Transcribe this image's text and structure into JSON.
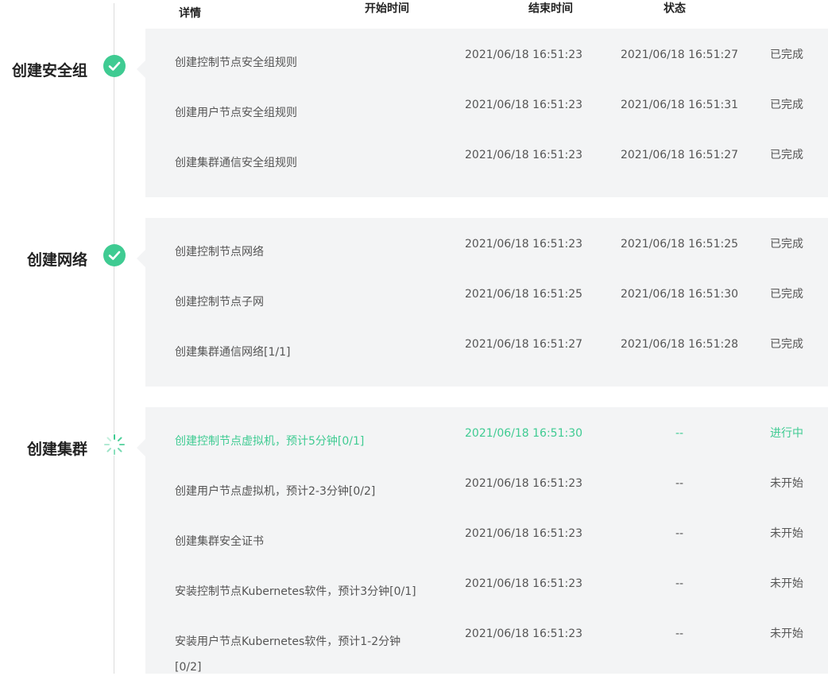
{
  "header": {
    "detail": "详情",
    "start_time": "开始时间",
    "end_time": "结束时间",
    "status": "状态"
  },
  "colors": {
    "accent": "#3fcb92",
    "panel_bg": "#f3f4f5"
  },
  "stages": [
    {
      "title": "创建安全组",
      "state": "done",
      "icon": "check-circle-icon",
      "rows": [
        {
          "detail": "创建控制节点安全组规则",
          "start": "2021/06/18 16:51:23",
          "end": "2021/06/18 16:51:27",
          "status": "已完成"
        },
        {
          "detail": "创建用户节点安全组规则",
          "start": "2021/06/18 16:51:23",
          "end": "2021/06/18 16:51:31",
          "status": "已完成"
        },
        {
          "detail": "创建集群通信安全组规则",
          "start": "2021/06/18 16:51:23",
          "end": "2021/06/18 16:51:27",
          "status": "已完成"
        }
      ]
    },
    {
      "title": "创建网络",
      "state": "done",
      "icon": "check-circle-icon",
      "rows": [
        {
          "detail": "创建控制节点网络",
          "start": "2021/06/18 16:51:23",
          "end": "2021/06/18 16:51:25",
          "status": "已完成"
        },
        {
          "detail": "创建控制节点子网",
          "start": "2021/06/18 16:51:25",
          "end": "2021/06/18 16:51:30",
          "status": "已完成"
        },
        {
          "detail": "创建集群通信网络[1/1]",
          "start": "2021/06/18 16:51:27",
          "end": "2021/06/18 16:51:28",
          "status": "已完成"
        }
      ]
    },
    {
      "title": "创建集群",
      "state": "in-progress",
      "icon": "loading-spinner-icon",
      "rows": [
        {
          "detail": "创建控制节点虚拟机，预计5分钟[0/1]",
          "start": "2021/06/18 16:51:30",
          "end": "--",
          "status": "进行中",
          "active": true
        },
        {
          "detail": "创建用户节点虚拟机，预计2-3分钟[0/2]",
          "start": "2021/06/18 16:51:23",
          "end": "--",
          "status": "未开始"
        },
        {
          "detail": "创建集群安全证书",
          "start": "2021/06/18 16:51:23",
          "end": "--",
          "status": "未开始"
        },
        {
          "detail": "安装控制节点Kubernetes软件，预计3分钟[0/1]",
          "start": "2021/06/18 16:51:23",
          "end": "--",
          "status": "未开始"
        },
        {
          "detail": "安装用户节点Kubernetes软件，预计1-2分钟[0/2]",
          "start": "2021/06/18 16:51:23",
          "end": "--",
          "status": "未开始"
        }
      ]
    }
  ]
}
